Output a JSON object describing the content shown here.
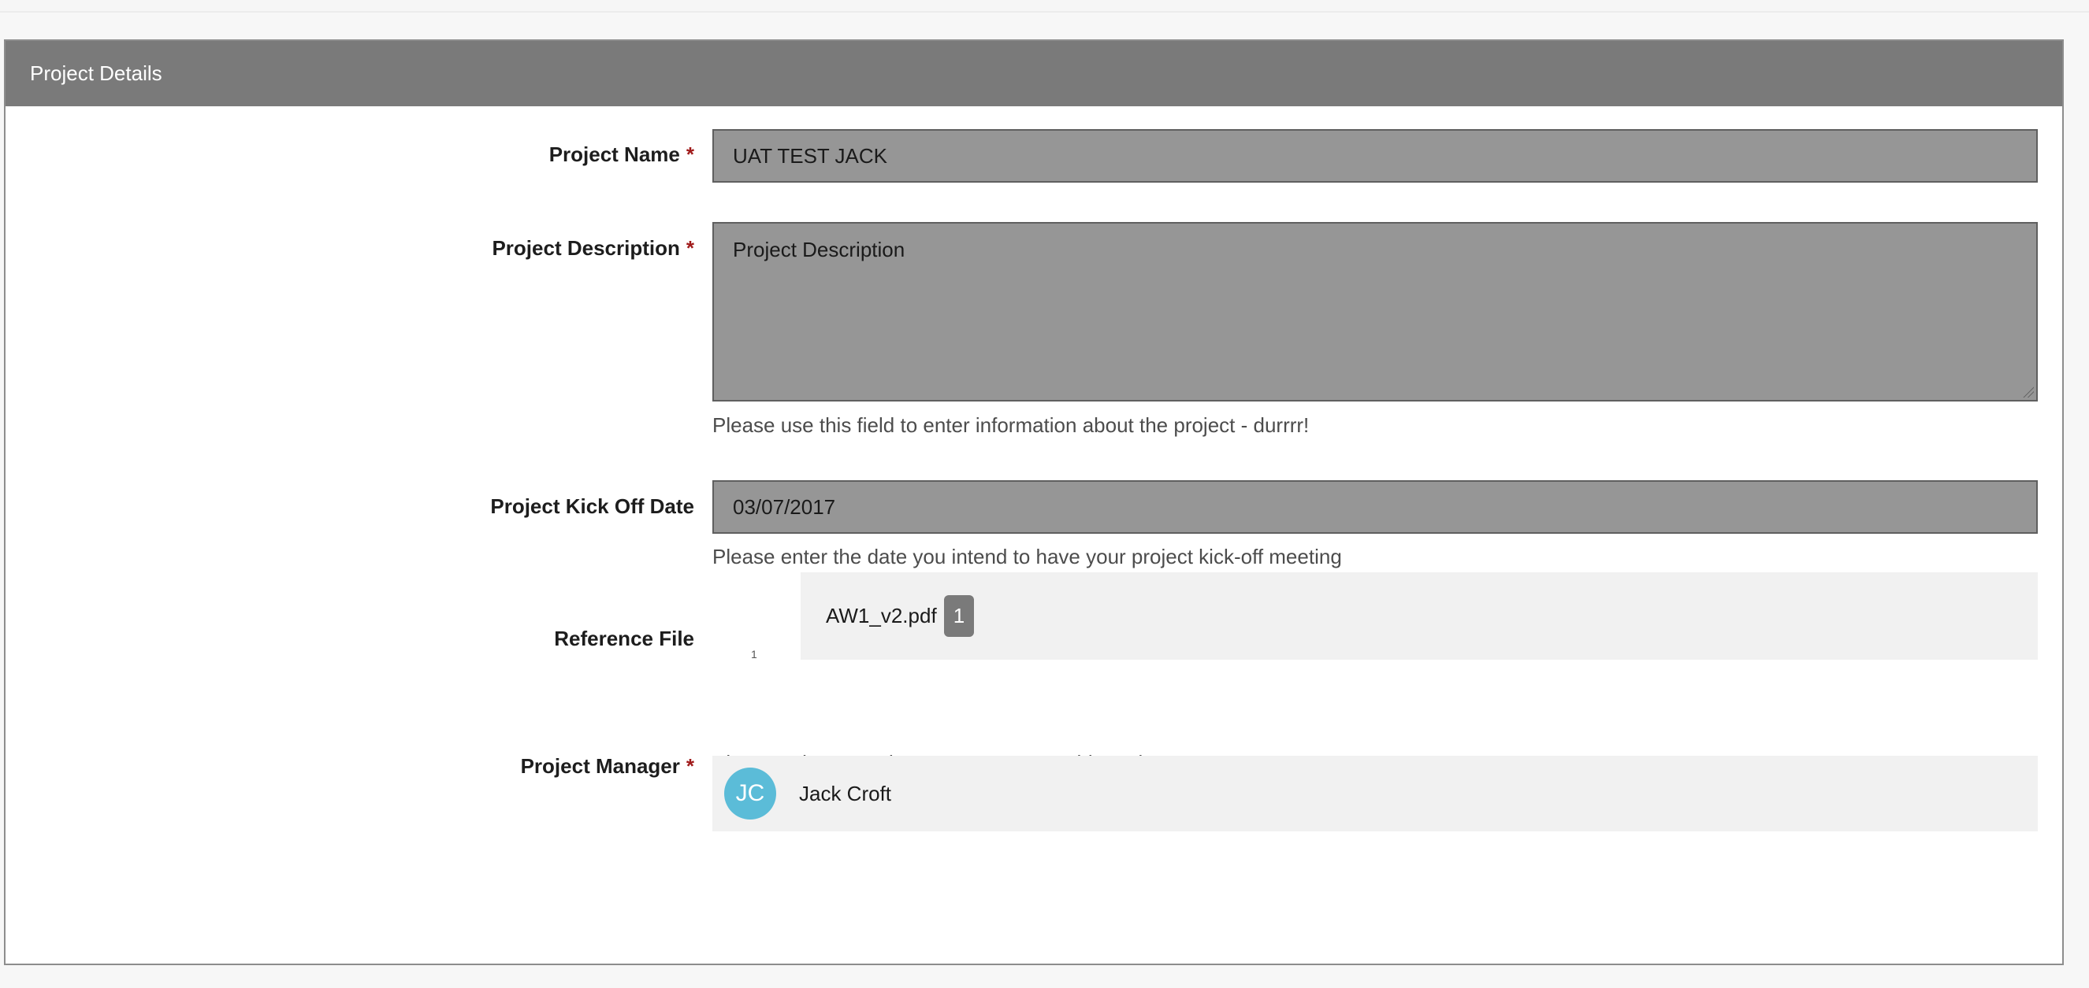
{
  "panel": {
    "title": "Project Details"
  },
  "fields": {
    "project_name": {
      "label": "Project Name",
      "required_mark": "*",
      "value": "UAT TEST JACK"
    },
    "project_description": {
      "label": "Project Description",
      "required_mark": "*",
      "value": "Project Description",
      "help": "Please use this field to enter information about the project - durrrr!"
    },
    "kickoff_date": {
      "label": "Project Kick Off Date",
      "value": "03/07/2017",
      "help": "Please enter the date you intend to have your project kick-off meeting"
    },
    "reference_file": {
      "label": "Reference File",
      "icon_text": "1",
      "file_name": "AW1_v2.pdf",
      "badge": "1"
    },
    "project_manager": {
      "label": "Project Manager",
      "required_mark": "*",
      "help": "Please select a Project Manager to run this project.",
      "initials": "JC",
      "name": "Jack Croft",
      "avatar_color": "#5bbcd8"
    }
  }
}
